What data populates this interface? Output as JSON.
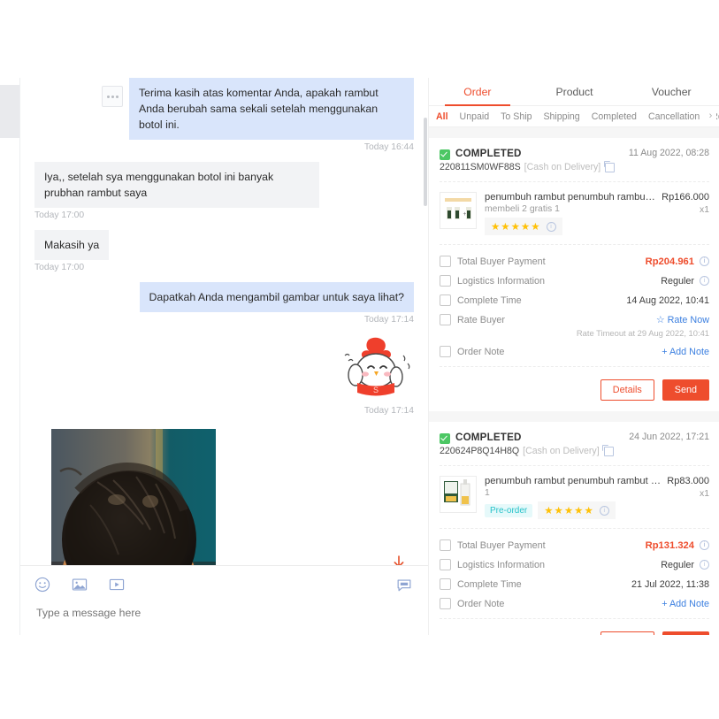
{
  "chat": {
    "messages": [
      {
        "side": "out",
        "text": "Terima kasih atas komentar Anda, apakah rambut Anda berubah sama sekali setelah menggunakan botol ini.",
        "time": "Today 16:44",
        "has_dots": true
      },
      {
        "side": "in",
        "text": "Iya,, setelah sya menggunakan botol ini banyak prubhan rambut saya",
        "time": "Today 17:00",
        "has_dots": false
      },
      {
        "side": "in",
        "text": "Makasih ya",
        "time": "Today 17:00",
        "has_dots": false
      },
      {
        "side": "out",
        "text": "Dapatkah Anda mengambil gambar untuk saya lihat?",
        "time": "Today 17:14",
        "has_dots": false
      }
    ],
    "sticker": {
      "time": "Today 17:14",
      "name": "chicken-sticker",
      "letter": "S"
    },
    "photo": {
      "name": "scalp-photo",
      "alt": "photo of back of head with dark hair"
    },
    "download_icon": "download-icon",
    "toolbar": {
      "emoji_icon": "emoji-icon",
      "image_icon": "image-icon",
      "video_icon": "video-icon",
      "quick_reply_icon": "quick-reply-icon"
    },
    "input": {
      "value": "",
      "placeholder": "Type a message here"
    }
  },
  "orders_panel": {
    "top_tabs": [
      {
        "label": "Order",
        "active": true
      },
      {
        "label": "Product",
        "active": false
      },
      {
        "label": "Voucher",
        "active": false
      }
    ],
    "filters": [
      {
        "label": "All",
        "active": true
      },
      {
        "label": "Unpaid",
        "active": false
      },
      {
        "label": "To Ship",
        "active": false
      },
      {
        "label": "Shipping",
        "active": false
      },
      {
        "label": "Completed",
        "active": false
      },
      {
        "label": "Cancellation",
        "active": false
      },
      {
        "label": "Return R",
        "active": false
      }
    ],
    "next_arrow": "›",
    "cards": [
      {
        "status": "COMPLETED",
        "date": "11 Aug 2022, 08:28",
        "order_id": "220811SM0WF88S",
        "payment_method": "[Cash on Delivery]",
        "product": {
          "title": "penumbuh rambut penumbuh rambut botak…",
          "subtitle": "membeli 2 gratis 1",
          "price": "Rp166.000",
          "qty": "x1",
          "preorder": "",
          "stars": "★★★★★"
        },
        "rows": [
          {
            "label": "Total Buyer Payment",
            "value": "Rp204.961",
            "style": "money",
            "info": true
          },
          {
            "label": "Logistics Information",
            "value": "Reguler",
            "style": "plain",
            "info": true
          },
          {
            "label": "Complete Time",
            "value": "14 Aug 2022, 10:41",
            "style": "plain",
            "info": false
          },
          {
            "label": "Rate Buyer",
            "value": "☆ Rate Now",
            "style": "blue",
            "info": false,
            "note": "Rate Timeout at 29 Aug 2022, 10:41"
          },
          {
            "label": "Order Note",
            "value": "+ Add Note",
            "style": "blue",
            "info": false
          }
        ],
        "actions": {
          "details": "Details",
          "send": "Send"
        }
      },
      {
        "status": "COMPLETED",
        "date": "24 Jun 2022, 17:21",
        "order_id": "220624P8Q14H8Q",
        "payment_method": "[Cash on Delivery]",
        "product": {
          "title": "penumbuh rambut penumbuh rambut botak…",
          "subtitle": "1",
          "price": "Rp83.000",
          "qty": "x1",
          "preorder": "Pre-order",
          "stars": "★★★★★"
        },
        "rows": [
          {
            "label": "Total Buyer Payment",
            "value": "Rp131.324",
            "style": "money",
            "info": true
          },
          {
            "label": "Logistics Information",
            "value": "Reguler",
            "style": "plain",
            "info": true
          },
          {
            "label": "Complete Time",
            "value": "21 Jul 2022, 11:38",
            "style": "plain",
            "info": false
          },
          {
            "label": "Order Note",
            "value": "+ Add Note",
            "style": "blue",
            "info": false
          }
        ],
        "actions": {
          "details": "Details",
          "send": "Send"
        }
      }
    ]
  },
  "colors": {
    "accent": "#ee4d2d",
    "outgoing_bubble": "#d9e5fb",
    "incoming_bubble": "#f2f3f5",
    "link": "#3b7fe0",
    "success": "#4cc764",
    "star": "#ffc107",
    "preorder": "#26c2c9"
  }
}
